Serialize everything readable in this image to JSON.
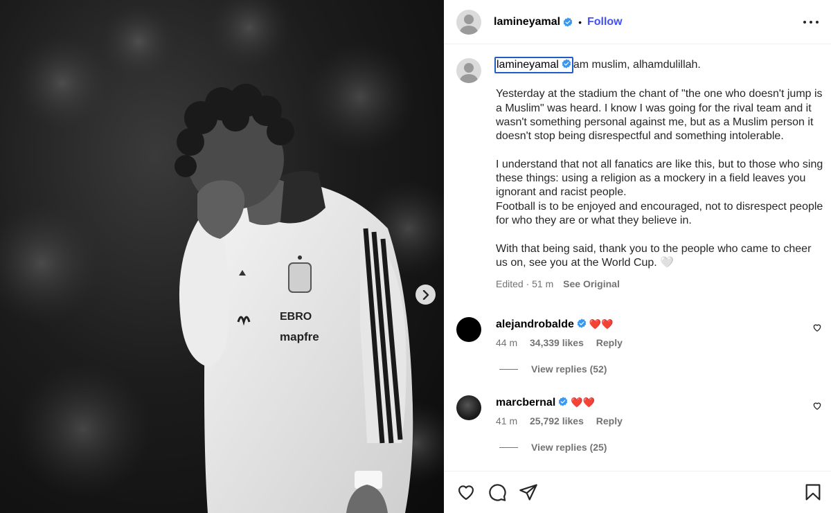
{
  "post": {
    "image_alt": "Black and white photo of a player in a white Spain national team track jacket covering his face with his hand",
    "jacket_text": [
      "EBRO",
      "mapfre"
    ]
  },
  "header": {
    "username": "lamineyamal",
    "follow_label": "Follow"
  },
  "caption": {
    "username": "lamineyamal",
    "first_line": "am muslim, alhamdulillah.",
    "paragraphs": [
      "Yesterday at the stadium the chant of \"the one who doesn't jump is a Muslim\" was heard. I know I was going for the rival team and it wasn't something personal against me, but as a Muslim person it doesn't stop being disrespectful and something intolerable.",
      "I understand that not all fanatics are like this, but to those who sing these things: using a religion as a mockery in a field leaves you ignorant and racist people.\nFootball is to be enjoyed and encouraged, not to disrespect people for who they are or what they believe in.",
      "With that being said, thank you to the people who came to cheer us on, see you at the World Cup. 🤍"
    ],
    "edited": "Edited · 51 m",
    "see_original": "See Original"
  },
  "comments": [
    {
      "username": "alejandrobalde",
      "text": "❤️❤️",
      "time": "44 m",
      "likes": "34,339 likes",
      "reply_label": "Reply",
      "view_replies": "View replies (52)"
    },
    {
      "username": "marcbernal",
      "text": "❤️❤️",
      "time": "41 m",
      "likes": "25,792 likes",
      "reply_label": "Reply",
      "view_replies": "View replies (25)"
    }
  ],
  "icons": {
    "verified": "verified-badge-icon",
    "like": "heart-icon",
    "comment": "comment-bubble-icon",
    "share": "paper-plane-icon",
    "save": "bookmark-icon",
    "more": "more-options-icon",
    "next": "chevron-right-icon"
  },
  "colors": {
    "follow": "#4150f7",
    "verified": "#3897f0",
    "muted": "#737373"
  }
}
